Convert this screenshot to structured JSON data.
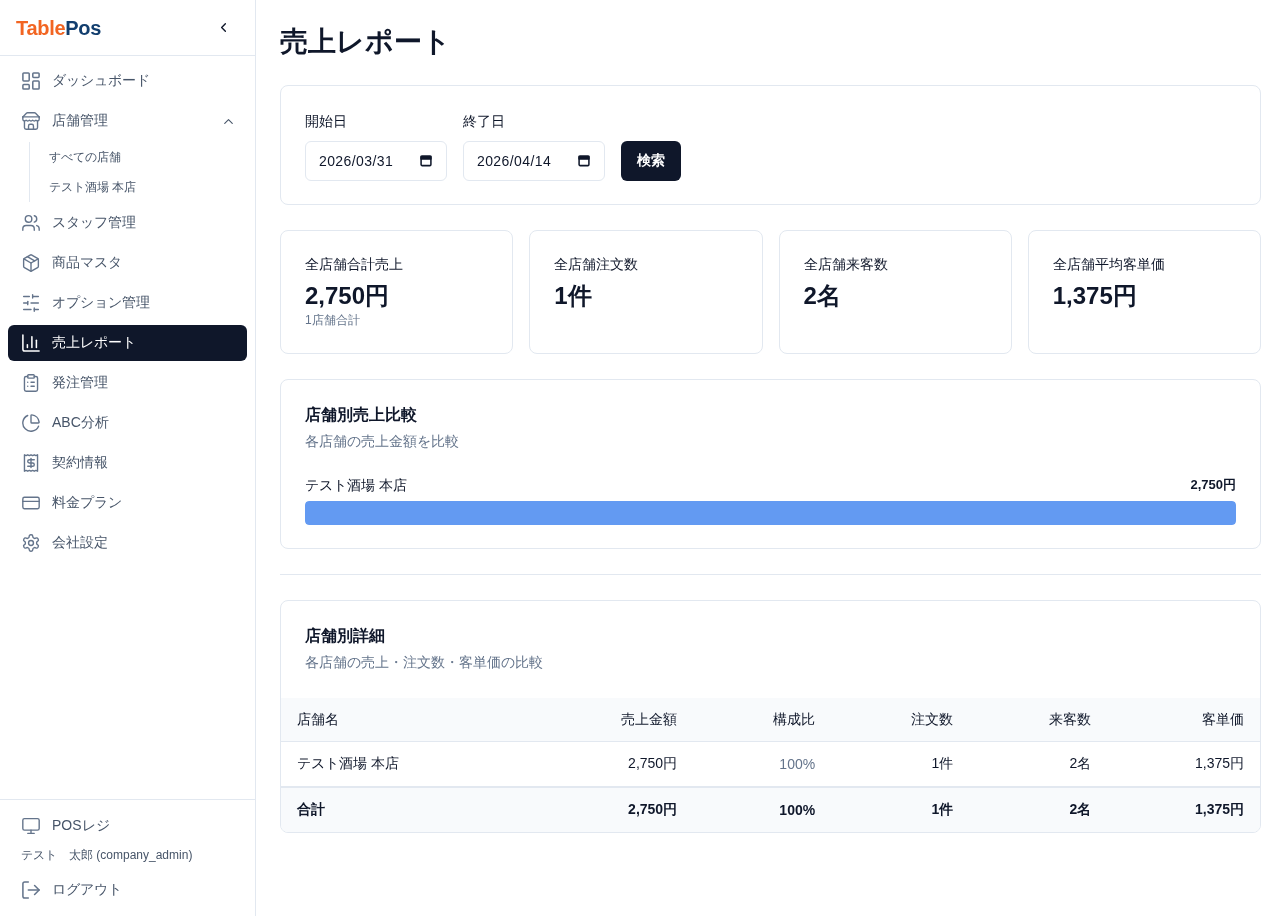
{
  "sidebar": {
    "logo": [
      {
        "text": "Table",
        "color": "#f26522"
      },
      {
        "text": "Pos",
        "color": "#123e6e"
      }
    ],
    "nav": [
      {
        "label": "ダッシュボード",
        "selected": false
      },
      {
        "label": "店舗管理",
        "selected": false,
        "expanded": true,
        "children": [
          {
            "label": "すべての店舗",
            "selected": false
          },
          {
            "label": "テスト酒場 本店",
            "selected": false
          }
        ]
      },
      {
        "label": "スタッフ管理",
        "selected": false
      },
      {
        "label": "商品マスタ",
        "selected": false
      },
      {
        "label": "オプション管理",
        "selected": false
      },
      {
        "label": "売上レポート",
        "selected": true
      },
      {
        "label": "発注管理",
        "selected": false
      },
      {
        "label": "ABC分析",
        "selected": false
      },
      {
        "label": "契約情報",
        "selected": false
      },
      {
        "label": "料金プラン",
        "selected": false
      },
      {
        "label": "会社設定",
        "selected": false
      }
    ],
    "footer": {
      "register_link": "POSレジ",
      "user": "テスト　太郎 (company_admin)",
      "logout": "ログアウト"
    }
  },
  "page_title": "売上レポート",
  "filter": {
    "fields": [
      {
        "label": "開始日",
        "value": "2026/03/31"
      },
      {
        "label": "終了日",
        "value": "2026/04/14"
      }
    ],
    "search_button": "検索"
  },
  "summary_cards": [
    {
      "label": "全店舗合計売上",
      "value": "2,750円",
      "note": "1店舗合計"
    },
    {
      "label": "全店舗注文数",
      "value": "1件"
    },
    {
      "label": "全店舗来客数",
      "value": "2名"
    },
    {
      "label": "全店舗平均客単価",
      "value": "1,375円"
    }
  ],
  "comparison": {
    "title": "店舗別売上比較",
    "subtitle": "各店舗の売上金額を比較",
    "bars": [
      {
        "store": "テスト酒場 本店",
        "amount": "2,750円",
        "level": 1
      }
    ]
  },
  "detail_table": {
    "title": "店舗別詳細",
    "subtitle": "各店舗の売上・注文数・客単価の比較",
    "columns": [
      "店舗名",
      "売上金額",
      "構成比",
      "注文数",
      "来客数",
      "客単価"
    ],
    "rows": [
      {
        "kind": "data",
        "cells": [
          "テスト酒場 本店",
          "2,750円",
          "100%",
          "1件",
          "2名",
          "1,375円"
        ]
      },
      {
        "kind": "total",
        "cells": [
          "合計",
          "2,750円",
          "100%",
          "1件",
          "2名",
          "1,375円"
        ]
      }
    ]
  }
}
